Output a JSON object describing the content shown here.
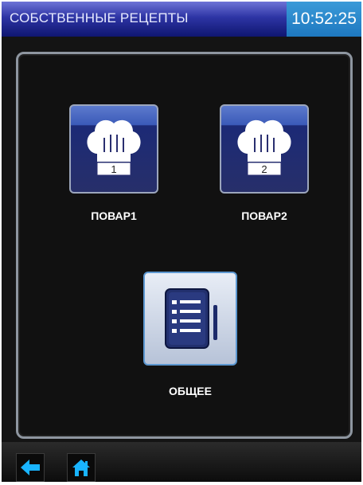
{
  "header": {
    "title": "СОБСТВЕННЫЕ РЕЦЕПТЫ",
    "time": "10:52:25"
  },
  "tiles": [
    {
      "label": "ПОВАР1",
      "badge": "1",
      "icon": "chef-hat-icon"
    },
    {
      "label": "ПОВАР2",
      "badge": "2",
      "icon": "chef-hat-icon"
    },
    {
      "label": "ОБЩЕЕ",
      "icon": "recipe-list-icon"
    }
  ],
  "bottom_nav": {
    "back_icon": "arrow-left-icon",
    "home_icon": "home-icon"
  },
  "colors": {
    "title_bar": "#2d34a4",
    "clock_bg": "#1e78c0",
    "accent_icon": "#19b4ff",
    "tile_bg": "#27306c"
  }
}
